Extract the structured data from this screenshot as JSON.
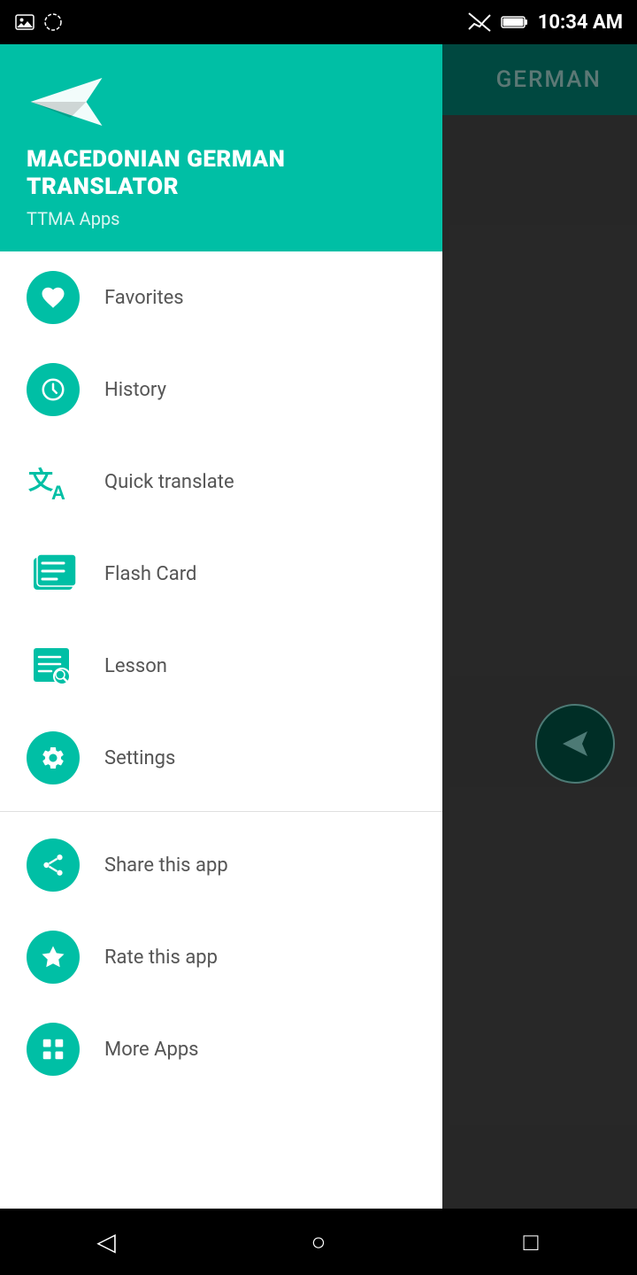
{
  "statusBar": {
    "time": "10:34 AM",
    "icons": [
      "photo-icon",
      "sync-icon",
      "signal-off-icon",
      "battery-icon"
    ]
  },
  "appBackground": {
    "languageLabel": "GERMAN"
  },
  "drawer": {
    "appName": "MACEDONIAN GERMAN",
    "appNameLine2": "TRANSLATOR",
    "subtitle": "TTMA Apps",
    "menuItems": [
      {
        "id": "favorites",
        "label": "Favorites",
        "iconType": "circle",
        "icon": "heart-icon"
      },
      {
        "id": "history",
        "label": "History",
        "iconType": "circle",
        "icon": "clock-icon"
      },
      {
        "id": "quick-translate",
        "label": "Quick translate",
        "iconType": "square",
        "icon": "translate-icon"
      },
      {
        "id": "flash-card",
        "label": "Flash Card",
        "iconType": "square",
        "icon": "flashcard-icon"
      },
      {
        "id": "lesson",
        "label": "Lesson",
        "iconType": "square",
        "icon": "lesson-icon"
      },
      {
        "id": "settings",
        "label": "Settings",
        "iconType": "circle",
        "icon": "gear-icon"
      }
    ],
    "secondaryItems": [
      {
        "id": "share",
        "label": "Share this app",
        "iconType": "circle",
        "icon": "share-icon"
      },
      {
        "id": "rate",
        "label": "Rate this app",
        "iconType": "circle",
        "icon": "star-icon"
      },
      {
        "id": "more-apps",
        "label": "More Apps",
        "iconType": "circle",
        "icon": "grid-icon"
      }
    ]
  },
  "navBar": {
    "back": "◁",
    "home": "○",
    "recent": "□"
  }
}
